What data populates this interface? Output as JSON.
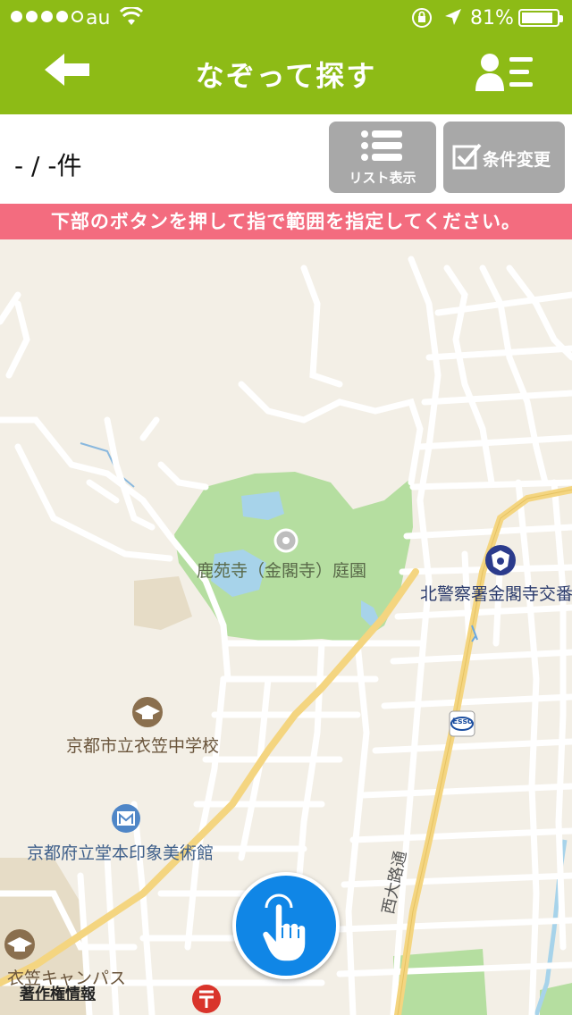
{
  "status_bar": {
    "carrier": "au",
    "battery_percent": "81%",
    "signal_bars_filled": 4,
    "signal_bars_total": 5
  },
  "nav": {
    "title": "なぞって探す",
    "back_icon": "back-arrow-icon",
    "menu_icon": "user-list-icon"
  },
  "toolbar": {
    "result_count": "- / -件",
    "list_button_label": "リスト表示",
    "condition_button_label": "条件変更"
  },
  "banner": {
    "text": "下部のボタンを押して指で範囲を指定してください。"
  },
  "map": {
    "labels": {
      "rokuonji": "鹿苑寺（金閣寺）庭園",
      "police": "北警察署金閣寺交番",
      "school": "京都市立衣笠中学校",
      "museum": "京都府立堂本印象美術館",
      "campus": "衣笠キャンパス",
      "street": "西大路通",
      "esso": "Esso"
    },
    "copyright": "著作権情報",
    "colors": {
      "park": "#b5dea0",
      "water": "#a7d3ea",
      "road_major": "#f4d580",
      "road_minor": "#ffffff"
    }
  },
  "draw_button": {
    "icon": "finger-touch-icon"
  },
  "colors": {
    "brand_green": "#8dbb16",
    "banner_pink": "#f36c7f",
    "button_gray": "#a8a8a8",
    "draw_blue": "#1086e6"
  }
}
